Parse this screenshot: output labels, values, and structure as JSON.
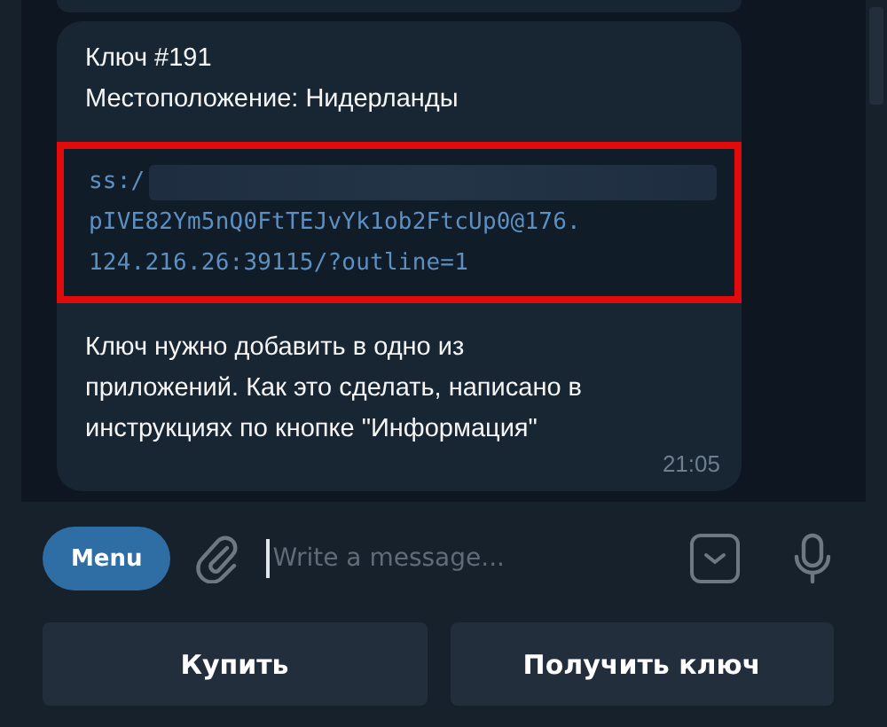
{
  "message": {
    "lines": [
      "Ключ #191",
      "Местоположение: Нидерланды"
    ],
    "key_lines": [
      "ss:/",
      "pIVE82Ym5nQ0FtTEJvYk1ob2FtcUp0@176.",
      "124.216.26:39115/?outline=1"
    ],
    "key_redacted": true,
    "highlighted": true,
    "note": "Ключ нужно добавить в одно из приложений. Как это сделать, написано в инструкциях по кнопке \"Информация\"",
    "time": "21:05"
  },
  "composer": {
    "menu_label": "Menu",
    "placeholder": "Write a message..."
  },
  "keyboard": [
    {
      "label": "Купить"
    },
    {
      "label": "Получить ключ"
    }
  ]
}
